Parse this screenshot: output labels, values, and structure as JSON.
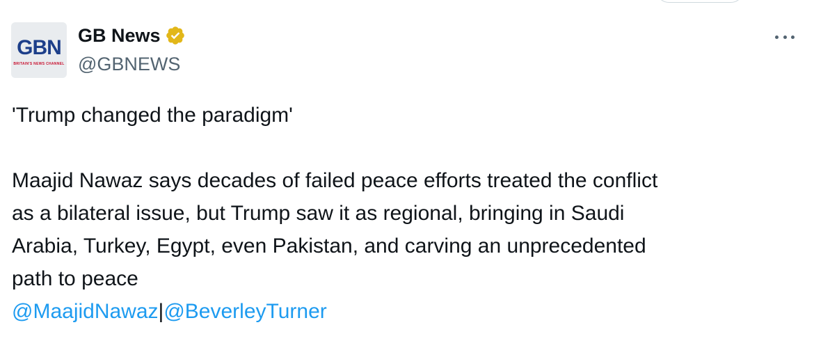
{
  "account": {
    "display_name": "GB News",
    "handle": "@GBNEWS",
    "verified": true,
    "verified_badge_color": "#e2b719",
    "avatar": {
      "logo_text": "GBN",
      "logo_subtitle": "BRITAIN'S NEWS CHANNEL",
      "logo_color": "#1d3f8a",
      "accent_color": "#c8102e"
    }
  },
  "menu": {
    "icon": "more-horizontal-icon"
  },
  "tweet": {
    "headline": "'Trump changed the paradigm'",
    "body_line_1": "Maajid Nawaz says decades of failed peace efforts treated the conflict",
    "body_line_2": "as a bilateral issue, but Trump saw it as regional, bringing in Saudi",
    "body_line_3": "Arabia, Turkey, Egypt, even Pakistan, and carving an unprecedented",
    "body_line_4": "path to peace",
    "mention_1": "@MaajidNawaz",
    "separator": "|",
    "mention_2": "@BeverleyTurner",
    "link_color": "#1d9bf0"
  }
}
